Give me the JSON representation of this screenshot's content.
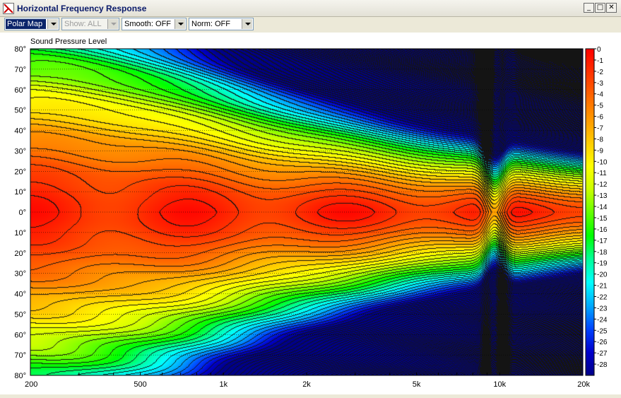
{
  "window": {
    "title": "Horizontal Frequency Response"
  },
  "window_buttons": {
    "minimize": "_",
    "maximize": "□",
    "close": "✕"
  },
  "toolbar": {
    "view": {
      "value": "Polar Map"
    },
    "show": {
      "value": "Show: ALL",
      "disabled": true
    },
    "smooth": {
      "value": "Smooth: OFF"
    },
    "norm": {
      "value": "Norm: OFF"
    }
  },
  "chart_data": {
    "type": "heatmap",
    "title": "Sound Pressure Level",
    "x_scale": "log",
    "x_range_hz": [
      200,
      20000
    ],
    "x_ticks": [
      {
        "value": 200,
        "label": "200"
      },
      {
        "value": 500,
        "label": "500"
      },
      {
        "value": 1000,
        "label": "1k"
      },
      {
        "value": 2000,
        "label": "2k"
      },
      {
        "value": 5000,
        "label": "5k"
      },
      {
        "value": 10000,
        "label": "10k"
      },
      {
        "value": 20000,
        "label": "20k"
      }
    ],
    "y_range_deg": [
      -80,
      80
    ],
    "y_ticks": [
      {
        "value": 80,
        "label": "80°"
      },
      {
        "value": 70,
        "label": "70°"
      },
      {
        "value": 60,
        "label": "60°"
      },
      {
        "value": 50,
        "label": "50°"
      },
      {
        "value": 40,
        "label": "40°"
      },
      {
        "value": 30,
        "label": "30°"
      },
      {
        "value": 20,
        "label": "20°"
      },
      {
        "value": 10,
        "label": "10°"
      },
      {
        "value": 0,
        "label": "0°"
      },
      {
        "value": -10,
        "label": "10°"
      },
      {
        "value": -20,
        "label": "20°"
      },
      {
        "value": -30,
        "label": "30°"
      },
      {
        "value": -40,
        "label": "40°"
      },
      {
        "value": -50,
        "label": "50°"
      },
      {
        "value": -60,
        "label": "60°"
      },
      {
        "value": -70,
        "label": "70°"
      },
      {
        "value": -80,
        "label": "80°"
      }
    ],
    "grid": true,
    "colorbar": {
      "min": -29,
      "max": 0,
      "labels": [
        "0",
        "-1",
        "-2",
        "-3",
        "-4",
        "-5",
        "-6",
        "-7",
        "-8",
        "-9",
        "-10",
        "-11",
        "-12",
        "-13",
        "-14",
        "-15",
        "-16",
        "-17",
        "-18",
        "-19",
        "-20",
        "-21",
        "-22",
        "-23",
        "-24",
        "-25",
        "-26",
        "-27",
        "-28"
      ],
      "colors": [
        "#ff0000",
        "#ff3300",
        "#ff6600",
        "#ff9900",
        "#ffcc00",
        "#ffff00",
        "#ccff00",
        "#66ff00",
        "#00ff00",
        "#00ff99",
        "#00ffff",
        "#00aaff",
        "#0044ff",
        "#0000cc",
        "#000088"
      ]
    },
    "contour_step_db": 1
  }
}
